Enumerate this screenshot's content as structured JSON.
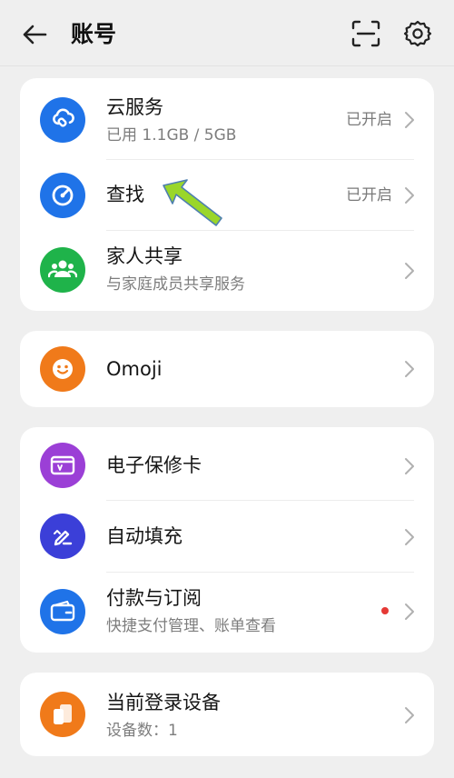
{
  "header": {
    "title": "账号"
  },
  "cards": {
    "services": {
      "cloud": {
        "title": "云服务",
        "subtitle": "已用 1.1GB / 5GB",
        "status": "已开启",
        "icon": "cloud-link-icon",
        "color": "#1f73e8"
      },
      "find": {
        "title": "查找",
        "status": "已开启",
        "icon": "radar-icon",
        "color": "#1f73e8"
      },
      "family": {
        "title": "家人共享",
        "subtitle": "与家庭成员共享服务",
        "icon": "family-icon",
        "color": "#1fb34a"
      }
    },
    "omoji": {
      "title": "Omoji",
      "icon": "smiley-icon",
      "color": "#f07a1a"
    },
    "wallet": {
      "warranty": {
        "title": "电子保修卡",
        "icon": "warranty-card-icon",
        "color": "#9b3fd6"
      },
      "autofill": {
        "title": "自动填充",
        "icon": "autofill-pen-icon",
        "color": "#3b3fd8"
      },
      "payment": {
        "title": "付款与订阅",
        "subtitle": "快捷支付管理、账单查看",
        "icon": "wallet-icon",
        "color": "#1f73e8"
      }
    },
    "devices": {
      "title": "当前登录设备",
      "subtitle": "设备数：1",
      "icon": "devices-icon",
      "color": "#f07a1a"
    }
  },
  "colors": {
    "background": "#efefef",
    "card": "#ffffff",
    "accent_arrow": "#9ad62a",
    "badge_red": "#e53935"
  }
}
